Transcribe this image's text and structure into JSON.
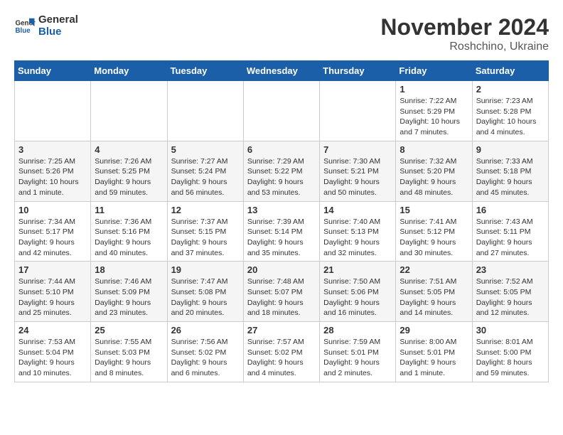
{
  "header": {
    "logo_line1": "General",
    "logo_line2": "Blue",
    "month_year": "November 2024",
    "location": "Roshchino, Ukraine"
  },
  "weekdays": [
    "Sunday",
    "Monday",
    "Tuesday",
    "Wednesday",
    "Thursday",
    "Friday",
    "Saturday"
  ],
  "weeks": [
    [
      {
        "day": "",
        "info": ""
      },
      {
        "day": "",
        "info": ""
      },
      {
        "day": "",
        "info": ""
      },
      {
        "day": "",
        "info": ""
      },
      {
        "day": "",
        "info": ""
      },
      {
        "day": "1",
        "info": "Sunrise: 7:22 AM\nSunset: 5:29 PM\nDaylight: 10 hours\nand 7 minutes."
      },
      {
        "day": "2",
        "info": "Sunrise: 7:23 AM\nSunset: 5:28 PM\nDaylight: 10 hours\nand 4 minutes."
      }
    ],
    [
      {
        "day": "3",
        "info": "Sunrise: 7:25 AM\nSunset: 5:26 PM\nDaylight: 10 hours\nand 1 minute."
      },
      {
        "day": "4",
        "info": "Sunrise: 7:26 AM\nSunset: 5:25 PM\nDaylight: 9 hours\nand 59 minutes."
      },
      {
        "day": "5",
        "info": "Sunrise: 7:27 AM\nSunset: 5:24 PM\nDaylight: 9 hours\nand 56 minutes."
      },
      {
        "day": "6",
        "info": "Sunrise: 7:29 AM\nSunset: 5:22 PM\nDaylight: 9 hours\nand 53 minutes."
      },
      {
        "day": "7",
        "info": "Sunrise: 7:30 AM\nSunset: 5:21 PM\nDaylight: 9 hours\nand 50 minutes."
      },
      {
        "day": "8",
        "info": "Sunrise: 7:32 AM\nSunset: 5:20 PM\nDaylight: 9 hours\nand 48 minutes."
      },
      {
        "day": "9",
        "info": "Sunrise: 7:33 AM\nSunset: 5:18 PM\nDaylight: 9 hours\nand 45 minutes."
      }
    ],
    [
      {
        "day": "10",
        "info": "Sunrise: 7:34 AM\nSunset: 5:17 PM\nDaylight: 9 hours\nand 42 minutes."
      },
      {
        "day": "11",
        "info": "Sunrise: 7:36 AM\nSunset: 5:16 PM\nDaylight: 9 hours\nand 40 minutes."
      },
      {
        "day": "12",
        "info": "Sunrise: 7:37 AM\nSunset: 5:15 PM\nDaylight: 9 hours\nand 37 minutes."
      },
      {
        "day": "13",
        "info": "Sunrise: 7:39 AM\nSunset: 5:14 PM\nDaylight: 9 hours\nand 35 minutes."
      },
      {
        "day": "14",
        "info": "Sunrise: 7:40 AM\nSunset: 5:13 PM\nDaylight: 9 hours\nand 32 minutes."
      },
      {
        "day": "15",
        "info": "Sunrise: 7:41 AM\nSunset: 5:12 PM\nDaylight: 9 hours\nand 30 minutes."
      },
      {
        "day": "16",
        "info": "Sunrise: 7:43 AM\nSunset: 5:11 PM\nDaylight: 9 hours\nand 27 minutes."
      }
    ],
    [
      {
        "day": "17",
        "info": "Sunrise: 7:44 AM\nSunset: 5:10 PM\nDaylight: 9 hours\nand 25 minutes."
      },
      {
        "day": "18",
        "info": "Sunrise: 7:46 AM\nSunset: 5:09 PM\nDaylight: 9 hours\nand 23 minutes."
      },
      {
        "day": "19",
        "info": "Sunrise: 7:47 AM\nSunset: 5:08 PM\nDaylight: 9 hours\nand 20 minutes."
      },
      {
        "day": "20",
        "info": "Sunrise: 7:48 AM\nSunset: 5:07 PM\nDaylight: 9 hours\nand 18 minutes."
      },
      {
        "day": "21",
        "info": "Sunrise: 7:50 AM\nSunset: 5:06 PM\nDaylight: 9 hours\nand 16 minutes."
      },
      {
        "day": "22",
        "info": "Sunrise: 7:51 AM\nSunset: 5:05 PM\nDaylight: 9 hours\nand 14 minutes."
      },
      {
        "day": "23",
        "info": "Sunrise: 7:52 AM\nSunset: 5:05 PM\nDaylight: 9 hours\nand 12 minutes."
      }
    ],
    [
      {
        "day": "24",
        "info": "Sunrise: 7:53 AM\nSunset: 5:04 PM\nDaylight: 9 hours\nand 10 minutes."
      },
      {
        "day": "25",
        "info": "Sunrise: 7:55 AM\nSunset: 5:03 PM\nDaylight: 9 hours\nand 8 minutes."
      },
      {
        "day": "26",
        "info": "Sunrise: 7:56 AM\nSunset: 5:02 PM\nDaylight: 9 hours\nand 6 minutes."
      },
      {
        "day": "27",
        "info": "Sunrise: 7:57 AM\nSunset: 5:02 PM\nDaylight: 9 hours\nand 4 minutes."
      },
      {
        "day": "28",
        "info": "Sunrise: 7:59 AM\nSunset: 5:01 PM\nDaylight: 9 hours\nand 2 minutes."
      },
      {
        "day": "29",
        "info": "Sunrise: 8:00 AM\nSunset: 5:01 PM\nDaylight: 9 hours\nand 1 minute."
      },
      {
        "day": "30",
        "info": "Sunrise: 8:01 AM\nSunset: 5:00 PM\nDaylight: 8 hours\nand 59 minutes."
      }
    ]
  ]
}
